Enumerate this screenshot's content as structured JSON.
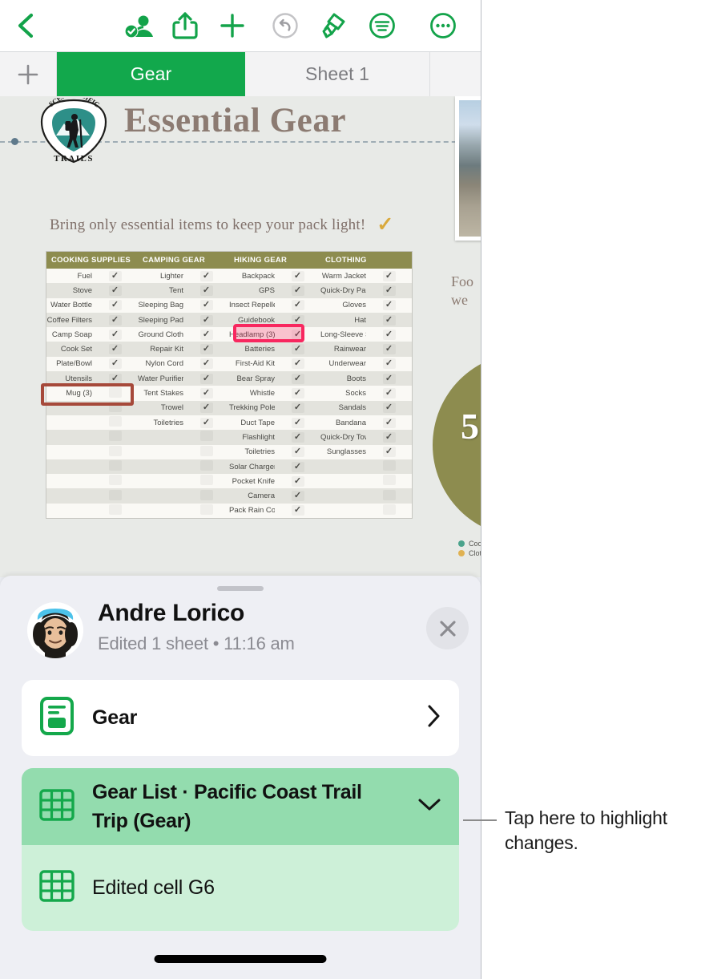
{
  "toolbar": {
    "icons": [
      {
        "name": "back-chevron-icon",
        "label": "Back"
      },
      {
        "name": "collaborate-icon",
        "label": "Collaborate"
      },
      {
        "name": "share-icon",
        "label": "Share"
      },
      {
        "name": "insert-icon",
        "label": "Insert"
      },
      {
        "name": "undo-icon",
        "label": "Undo"
      },
      {
        "name": "format-brush-icon",
        "label": "Format"
      },
      {
        "name": "document-options-icon",
        "label": "Document Options"
      },
      {
        "name": "more-icon",
        "label": "More"
      }
    ]
  },
  "tabbar": {
    "add_label": "+",
    "tabs": [
      {
        "label": "Gear",
        "active": true
      },
      {
        "label": "Sheet 1",
        "active": false
      }
    ]
  },
  "canvas": {
    "logo_text_top": "SCENIC",
    "logo_text_right": "PACIFIC",
    "logo_text_bottom": "TRAILS",
    "doc_title": "Essential Gear",
    "subtitle": "Bring only essential items to keep your pack light!",
    "subtitle_check": "✓",
    "footer_text_partial": "Foo\nwe",
    "donut_value": "5",
    "legend": [
      {
        "label": "Cooki",
        "color": "#4aa38c"
      },
      {
        "label": "Clothi",
        "color": "#e0b252"
      }
    ]
  },
  "table": {
    "headers": [
      "COOKING SUPPLIES",
      "CAMPING GEAR",
      "HIKING GEAR",
      "CLOTHING"
    ],
    "rows": [
      {
        "c1": "Fuel",
        "k1": true,
        "c2": "Lighter",
        "k2": true,
        "c3": "Backpack",
        "k3": true,
        "c4": "Warm Jacket",
        "k4": true
      },
      {
        "c1": "Stove",
        "k1": true,
        "c2": "Tent",
        "k2": true,
        "c3": "GPS",
        "k3": true,
        "c4": "Quick-Dry Pants",
        "k4": true
      },
      {
        "c1": "Water Bottle",
        "k1": true,
        "c2": "Sleeping Bag",
        "k2": true,
        "c3": "Insect Repellent",
        "k3": true,
        "c4": "Gloves",
        "k4": true
      },
      {
        "c1": "Coffee Filters",
        "k1": true,
        "c2": "Sleeping Pad",
        "k2": true,
        "c3": "Guidebook",
        "k3": true,
        "c4": "Hat",
        "k4": true
      },
      {
        "c1": "Camp Soap",
        "k1": true,
        "c2": "Ground Cloth",
        "k2": true,
        "c3": "Headlamp (3)",
        "k3": true,
        "c4": "Long-Sleeve Shirts",
        "k4": true
      },
      {
        "c1": "Cook Set",
        "k1": true,
        "c2": "Repair Kit",
        "k2": true,
        "c3": "Batteries",
        "k3": true,
        "c4": "Rainwear",
        "k4": true
      },
      {
        "c1": "Plate/Bowl",
        "k1": true,
        "c2": "Nylon Cord",
        "k2": true,
        "c3": "First-Aid Kit",
        "k3": true,
        "c4": "Underwear",
        "k4": true
      },
      {
        "c1": "Utensils",
        "k1": true,
        "c2": "Water Purifier",
        "k2": true,
        "c3": "Bear Spray",
        "k3": true,
        "c4": "Boots",
        "k4": true
      },
      {
        "c1": "Mug (3)",
        "k1": false,
        "c2": "Tent Stakes",
        "k2": true,
        "c3": "Whistle",
        "k3": true,
        "c4": "Socks",
        "k4": true
      },
      {
        "c1": "",
        "k1": false,
        "c2": "Trowel",
        "k2": true,
        "c3": "Trekking Poles",
        "k3": true,
        "c4": "Sandals",
        "k4": true
      },
      {
        "c1": "",
        "k1": false,
        "c2": "Toiletries",
        "k2": true,
        "c3": "Duct Tape",
        "k3": true,
        "c4": "Bandana",
        "k4": true
      },
      {
        "c1": "",
        "k1": false,
        "c2": "",
        "k2": false,
        "c3": "Flashlight",
        "k3": true,
        "c4": "Quick-Dry Towel",
        "k4": true
      },
      {
        "c1": "",
        "k1": false,
        "c2": "",
        "k2": false,
        "c3": "Toiletries",
        "k3": true,
        "c4": "Sunglasses",
        "k4": true
      },
      {
        "c1": "",
        "k1": false,
        "c2": "",
        "k2": false,
        "c3": "Solar Charger",
        "k3": true,
        "c4": "",
        "k4": false
      },
      {
        "c1": "",
        "k1": false,
        "c2": "",
        "k2": false,
        "c3": "Pocket Knife",
        "k3": true,
        "c4": "",
        "k4": false
      },
      {
        "c1": "",
        "k1": false,
        "c2": "",
        "k2": false,
        "c3": "Camera",
        "k3": true,
        "c4": "",
        "k4": false
      },
      {
        "c1": "",
        "k1": false,
        "c2": "",
        "k2": false,
        "c3": "Pack Rain Cover",
        "k3": true,
        "c4": "",
        "k4": false
      }
    ],
    "highlight_pink_cell": "Headlamp (3)",
    "highlight_brown_cell": "Mug (3)",
    "highlight_pink_color": "#f8275f",
    "highlight_brown_color": "#a6493a"
  },
  "sheet": {
    "person_name": "Andre Lorico",
    "person_subtitle": "Edited 1 sheet • 11:16 am",
    "close_label": "✕",
    "gear_card_label": "Gear",
    "change_title": "Gear List · Pacific Coast Trail Trip (Gear)",
    "change_sub": "Edited cell G6"
  },
  "callout": {
    "text": "Tap here to highlight changes."
  }
}
